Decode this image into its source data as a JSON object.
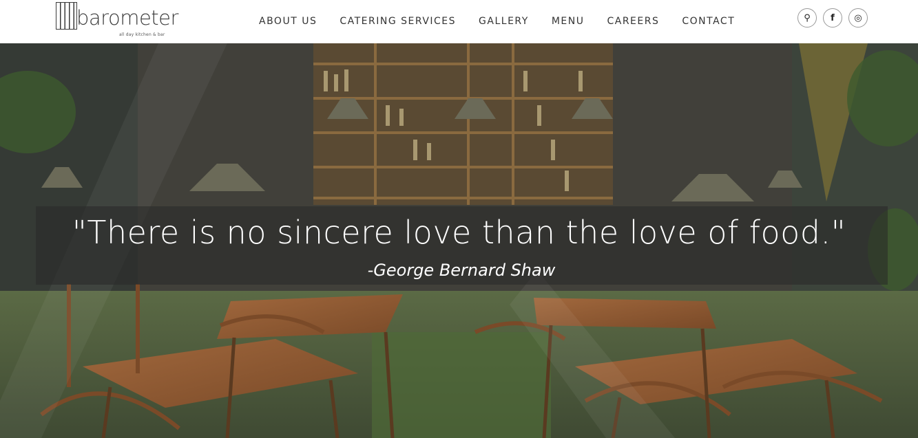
{
  "brand": {
    "logo_text": "barometer",
    "tagline": "all day kitchen & bar"
  },
  "nav": {
    "items": [
      {
        "label": "ABOUT US"
      },
      {
        "label": "CATERING SERVICES"
      },
      {
        "label": "GALLERY"
      },
      {
        "label": "MENU"
      },
      {
        "label": "CAREERS"
      },
      {
        "label": "CONTACT"
      }
    ]
  },
  "socials": [
    {
      "icon": "map-pin-icon",
      "glyph": "⚲"
    },
    {
      "icon": "facebook-icon",
      "glyph": "f"
    },
    {
      "icon": "instagram-icon",
      "glyph": "◎"
    }
  ],
  "hero": {
    "quote": "\"There is no sincere love than the love of food.\"",
    "author": "-George Bernard Shaw"
  },
  "colors": {
    "nav_text": "#333333",
    "quote_band": "#282828",
    "hero_text": "#ffffff"
  }
}
